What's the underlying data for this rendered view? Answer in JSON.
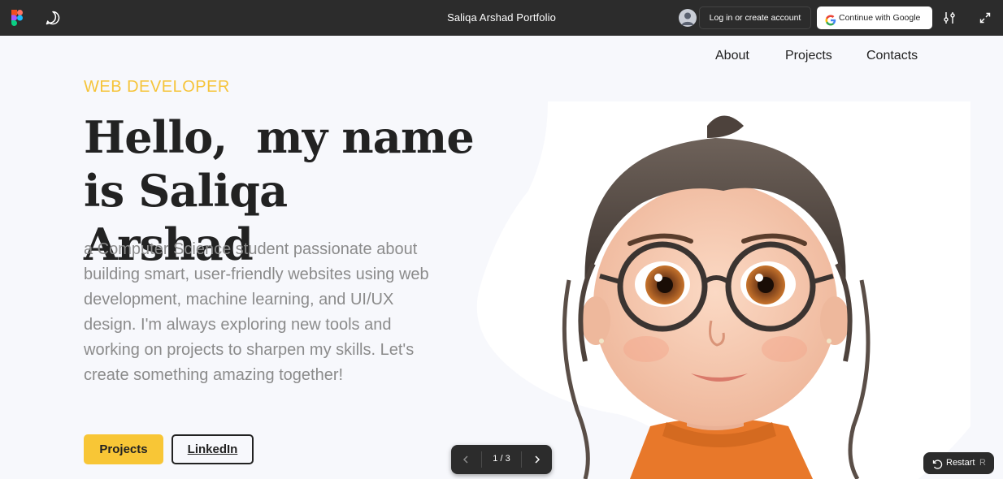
{
  "topbar": {
    "title": "Saliqa Arshad Portfolio",
    "login_label": "Log in or create account",
    "google_label": "Continue with Google",
    "icons": [
      "figma-logo-icon",
      "comment-icon",
      "user-avatar-icon",
      "google-icon",
      "settings-sliders-icon",
      "expand-icon"
    ]
  },
  "nav": {
    "items": [
      {
        "label": "About"
      },
      {
        "label": "Projects"
      },
      {
        "label": "Contacts"
      }
    ]
  },
  "hero": {
    "eyebrow": "WEB DEVELOPER",
    "headline_line1": "Hello,  my name",
    "headline_line2": "is Saliqa Arshad",
    "bio": "a  Computer Science student passionate about building smart, user-friendly websites using web development, machine learning, and UI/UX design. I'm always exploring new tools and working on projects to sharpen my skills. Let's create something amazing together!",
    "buttons": {
      "projects_label": "Projects",
      "linkedin_label": "LinkedIn"
    },
    "image_alt_icon": "cartoon-girl-portrait"
  },
  "slides": {
    "counter": "1 / 3"
  },
  "restart": {
    "label": "Restart",
    "shortcut": "R"
  },
  "colors": {
    "accent": "#f8c636",
    "topbar": "#2c2c2c",
    "background": "#f7f8fc",
    "text_dark": "#222222",
    "text_muted": "#8b8b8b"
  }
}
